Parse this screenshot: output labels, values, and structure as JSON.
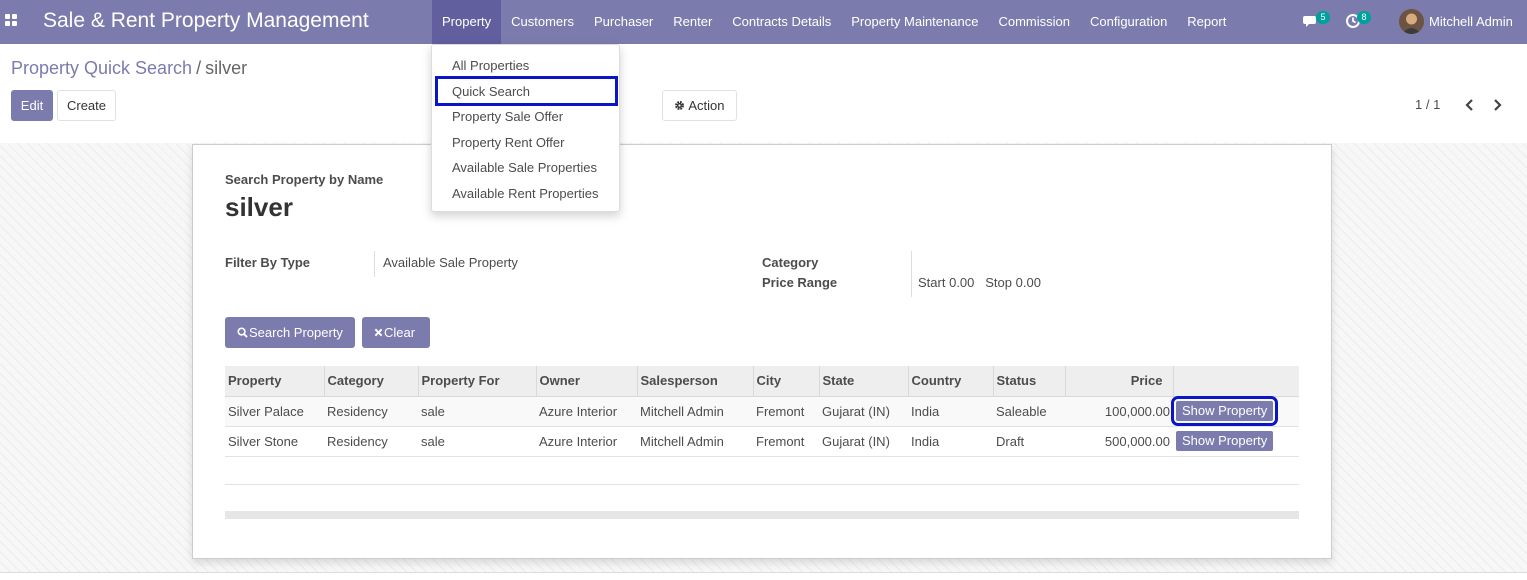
{
  "navbar": {
    "brand": "Sale & Rent Property Management",
    "menu": [
      "Property",
      "Customers",
      "Purchaser",
      "Renter",
      "Contracts Details",
      "Property Maintenance",
      "Commission",
      "Configuration",
      "Report"
    ],
    "active_menu": "Property",
    "messages_count": "5",
    "activities_count": "8",
    "user_name": "Mitchell Admin",
    "accent_color": "#7c7bad"
  },
  "dropdown": {
    "items": [
      "All Properties",
      "Quick Search",
      "Property Sale Offer",
      "Property Rent Offer",
      "Available Sale Properties",
      "Available Rent Properties"
    ],
    "highlighted": "Quick Search"
  },
  "control_panel": {
    "breadcrumb_parent": "Property Quick Search",
    "breadcrumb_separator": "/",
    "breadcrumb_current": "silver",
    "edit_label": "Edit",
    "create_label": "Create",
    "action_label": "Action",
    "pager": "1 / 1"
  },
  "form": {
    "search_label": "Search Property by Name",
    "search_value": "silver",
    "filter_label": "Filter By Type",
    "filter_value": "Available Sale Property",
    "category_label": "Category",
    "price_range_label": "Price Range",
    "start_label": "Start",
    "start_value": "0.00",
    "stop_label": "Stop",
    "stop_value": "0.00",
    "search_button": "Search Property",
    "clear_button": "Clear"
  },
  "table": {
    "columns": [
      "Property",
      "Category",
      "Property For",
      "Owner",
      "Salesperson",
      "City",
      "State",
      "Country",
      "Status",
      "Price",
      ""
    ],
    "rows": [
      [
        "Silver Palace",
        "Residency",
        "sale",
        "Azure Interior",
        "Mitchell Admin",
        "Fremont",
        "Gujarat (IN)",
        "India",
        "Saleable",
        "100,000.00",
        "Show Property"
      ],
      [
        "Silver Stone",
        "Residency",
        "sale",
        "Azure Interior",
        "Mitchell Admin",
        "Fremont",
        "Gujarat (IN)",
        "India",
        "Draft",
        "500,000.00",
        "Show Property"
      ]
    ]
  }
}
